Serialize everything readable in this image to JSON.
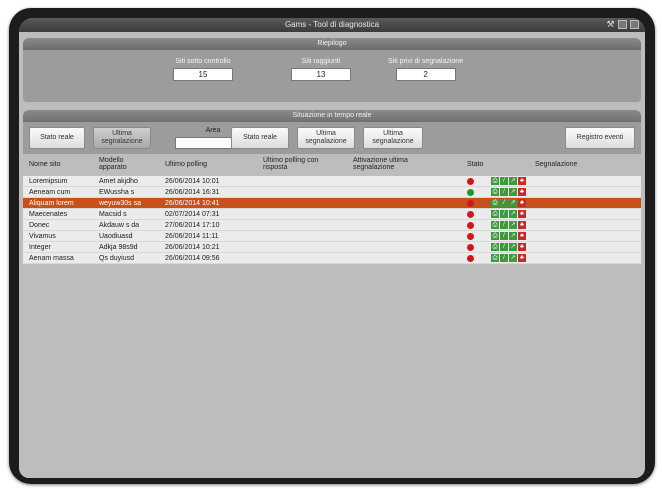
{
  "window": {
    "title": "Gams - Tool di diagnostica"
  },
  "summary": {
    "title": "Riepilogo",
    "stats": [
      {
        "label": "Siti sotto controllo",
        "value": "15"
      },
      {
        "label": "Siti raggiunti",
        "value": "13"
      },
      {
        "label": "Siti privi di segnalazione",
        "value": "2"
      }
    ]
  },
  "realtime": {
    "title": "Situazione in tempo reale",
    "buttons": {
      "stato_reale_1": "Stato reale",
      "ultima_segnalazione_1": "Ultima segnalazione",
      "area_label": "Area",
      "stato_reale_2": "Stato reale",
      "ultima_segnalazione_2": "Ultima segnalazione",
      "ultima_segnalazione_3": "Ultima segnalazione",
      "registro_eventi": "Registro eventi"
    },
    "columns": [
      "Nome sito",
      "Modello apparato",
      "Ultimo polling",
      "Ultimo polling con risposta",
      "Attivazione ultima segnalazione",
      "Stato",
      "Segnalazione"
    ],
    "rows": [
      {
        "nome": "Loremipsum",
        "modello": "Amet akjdho",
        "polling": "26/06/2014 10:01",
        "stato": "red"
      },
      {
        "nome": "Aeneam cum",
        "modello": "EWussha s",
        "polling": "26/06/2014 16:31",
        "stato": "green"
      },
      {
        "nome": "Aliquam lorem",
        "modello": "weyuw30s sa",
        "polling": "26/06/2014 10:41",
        "stato": "red"
      },
      {
        "nome": "Maecenates",
        "modello": "Macsid s",
        "polling": "02/07/2014 07:31",
        "stato": "red"
      },
      {
        "nome": "Donec",
        "modello": "Akdauw s da",
        "polling": "27/06/2014 17:10",
        "stato": "red"
      },
      {
        "nome": "Vivamus",
        "modello": "Uaodiuasd",
        "polling": "26/06/2014 11:11",
        "stato": "red"
      },
      {
        "nome": "Integer",
        "modello": "Adkja 98s9d",
        "polling": "26/06/2014 10:21",
        "stato": "red"
      },
      {
        "nome": "Aenam massa",
        "modello": "Qs duyiusd",
        "polling": "26/06/2014 09:56",
        "stato": "red"
      }
    ],
    "selected_row_index": 2
  },
  "colors": {
    "selection": "#c8501a",
    "status_red": "#d01818",
    "status_green": "#1f9a2a",
    "sign_green": "#3c9a3c",
    "sign_red": "#c42a2a"
  },
  "icons": [
    "wrench-icon",
    "minimize-icon",
    "close-icon",
    "printer-sign-icon",
    "pen-sign-icon",
    "tool-sign-icon",
    "alarm-sign-icon"
  ]
}
